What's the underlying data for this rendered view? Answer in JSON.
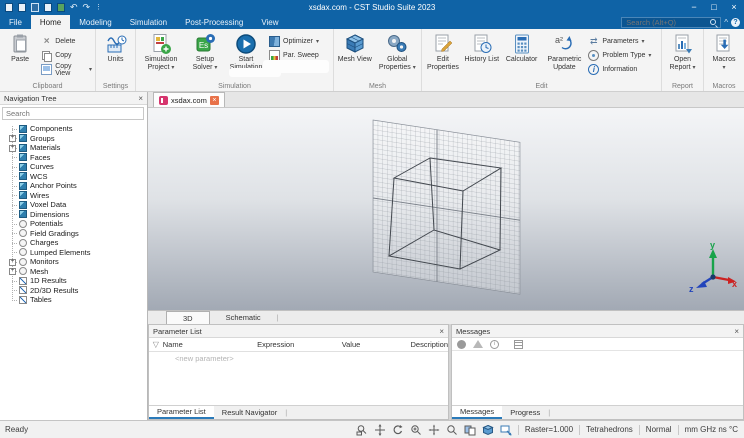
{
  "titlebar": {
    "title": "xsdax.com - CST Studio Suite 2023"
  },
  "window_controls": {
    "minimize": "−",
    "maximize": "□",
    "close": "×"
  },
  "icons": {
    "dropdown": "▾",
    "close": "×",
    "expand": "+",
    "play": "▶",
    "help": "?",
    "caret_up": "^",
    "undo": "↶",
    "redo": "↷",
    "filter": "▽",
    "info": "i",
    "parameters": "⇄"
  },
  "menu": {
    "tabs": [
      "File",
      "Home",
      "Modeling",
      "Simulation",
      "Post-Processing",
      "View"
    ],
    "active": "Home",
    "search_placeholder": "Search (Alt+Q)"
  },
  "ribbon": {
    "clipboard": {
      "group": "Clipboard",
      "paste": "Paste",
      "delete": "Delete",
      "copy": "Copy",
      "copy_view": "Copy View"
    },
    "settings": {
      "group": "Settings",
      "units": "Units"
    },
    "simulation": {
      "group": "Simulation",
      "simulation_project": "Simulation Project",
      "setup_solver": "Setup Solver",
      "start_simulation": "Start Simulation",
      "optimizer": "Optimizer",
      "par_sweep": "Par. Sweep"
    },
    "mesh": {
      "group": "Mesh",
      "mesh_view": "Mesh View",
      "global_properties": "Global Properties"
    },
    "edit": {
      "group": "Edit",
      "edit_properties": "Edit Properties",
      "history_list": "History List",
      "calculator": "Calculator",
      "parametric_update": "Parametric Update",
      "parameters": "Parameters",
      "problem_type": "Problem Type",
      "information": "Information"
    },
    "report": {
      "group": "Report",
      "open_report": "Open Report"
    },
    "macros_group": {
      "group": "Macros",
      "macros": "Macros"
    }
  },
  "navigation_tree": {
    "title": "Navigation Tree",
    "search_placeholder": "Search",
    "items": [
      "Components",
      "Groups",
      "Materials",
      "Faces",
      "Curves",
      "WCS",
      "Anchor Points",
      "Wires",
      "Voxel Data",
      "Dimensions",
      "Potentials",
      "Field Gradings",
      "Charges",
      "Lumped Elements",
      "Monitors",
      "Mesh",
      "1D Results",
      "2D/3D Results",
      "Tables"
    ]
  },
  "document": {
    "tab_title": "xsdax.com",
    "view_tabs": [
      "3D",
      "Schematic"
    ],
    "active_view_tab": "3D"
  },
  "axes": {
    "x": "x",
    "y": "y",
    "z": "z"
  },
  "parameter_list": {
    "title": "Parameter List",
    "columns": [
      "Name",
      "Expression",
      "Value",
      "Description"
    ],
    "placeholder_row": "<new parameter>",
    "tabs": [
      "Parameter List",
      "Result Navigator"
    ],
    "active_tab": "Parameter List"
  },
  "messages": {
    "title": "Messages",
    "tabs": [
      "Messages",
      "Progress"
    ],
    "active_tab": "Messages"
  },
  "statusbar": {
    "ready": "Ready",
    "raster": "Raster=1.000",
    "mesh_type": "Tetrahedrons",
    "view_mode": "Normal",
    "units": "mm GHz ns °C"
  },
  "colors": {
    "titlebar": "#0f63a6",
    "accent": "#2a7ab9",
    "doc_tab_close": "#e8724a",
    "doc_tab_icon": "#d6356e",
    "axis_x": "#cc2222",
    "axis_y": "#18a34a",
    "axis_z": "#2244bb"
  }
}
